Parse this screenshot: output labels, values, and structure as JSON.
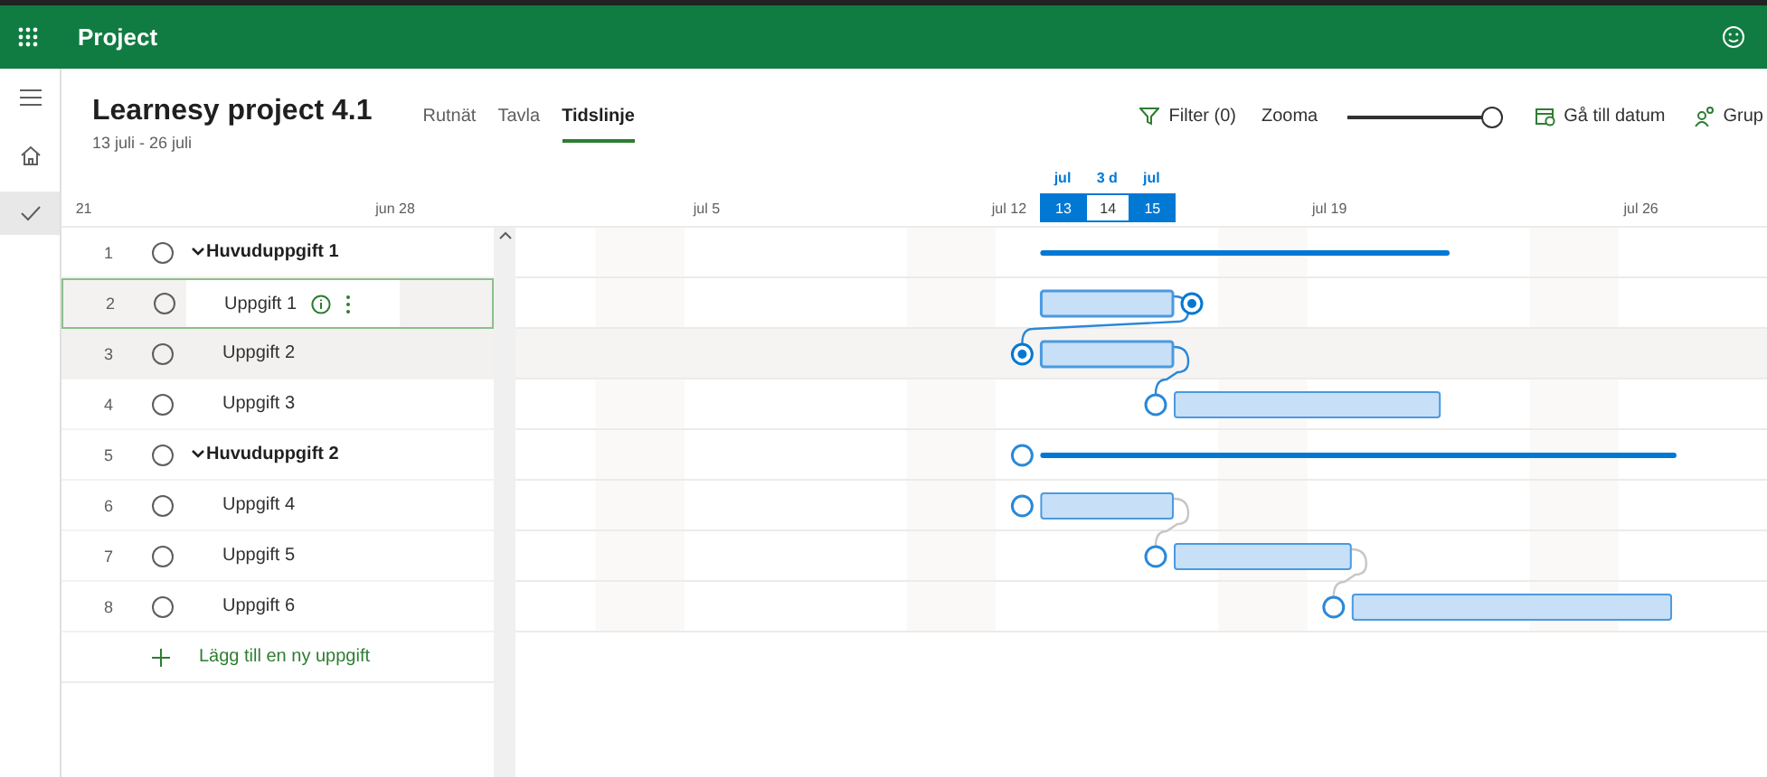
{
  "app": {
    "name": "Project"
  },
  "rail": [
    {
      "kind": "menu",
      "selected": false
    },
    {
      "kind": "home",
      "selected": false
    },
    {
      "kind": "check",
      "selected": true
    }
  ],
  "project": {
    "title": "Learnesy project 4.1",
    "dates": "13 juli - 26 juli"
  },
  "tabs": [
    {
      "label": "Rutnät",
      "selected": false
    },
    {
      "label": "Tavla",
      "selected": false
    },
    {
      "label": "Tidslinje",
      "selected": true
    }
  ],
  "toolbar": {
    "filter": "Filter (0)",
    "zoom_label": "Zooma",
    "zoom": {
      "level": 1
    },
    "goto": "Gå till datum",
    "group": "Grup"
  },
  "timescale": {
    "labels": [
      "21",
      "jun 28",
      "jul 5",
      "jul 12",
      "jul 19",
      "jul 26"
    ],
    "range_labels": [
      "jul",
      "3 d",
      "jul"
    ],
    "days": [
      {
        "label": "13",
        "selected": true
      },
      {
        "label": "14",
        "selected": false
      },
      {
        "label": "15",
        "selected": true
      }
    ]
  },
  "tasks": [
    {
      "number": "1",
      "name": "Huvuduppgift 1",
      "expanded": true,
      "selected": false,
      "hovered": false,
      "children": [
        {
          "number": "2",
          "name": "Uppgift 1",
          "selected": true,
          "hovered": false
        },
        {
          "number": "3",
          "name": "Uppgift 2",
          "selected": false,
          "hovered": true
        },
        {
          "number": "4",
          "name": "Uppgift 3",
          "selected": false,
          "hovered": false
        }
      ]
    },
    {
      "number": "5",
      "name": "Huvuduppgift 2",
      "expanded": true,
      "selected": false,
      "hovered": false,
      "children": [
        {
          "number": "6",
          "name": "Uppgift 4",
          "selected": false,
          "hovered": false
        },
        {
          "number": "7",
          "name": "Uppgift 5",
          "selected": false,
          "hovered": false
        },
        {
          "number": "8",
          "name": "Uppgift 6",
          "selected": false,
          "hovered": false
        }
      ]
    }
  ],
  "add_task": "Lägg till en ny uppgift"
}
